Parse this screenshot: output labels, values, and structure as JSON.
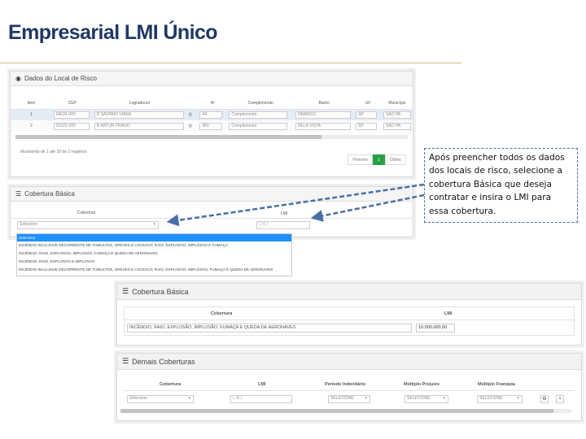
{
  "slide": {
    "title": "Empresarial LMI Único"
  },
  "risk_panel": {
    "title": "Dados do Local de Risco",
    "columns": [
      "Item",
      "CEP",
      "Logradouro",
      "",
      "Nº",
      "Complemento",
      "Bairro",
      "UF",
      "Município"
    ],
    "rows": [
      {
        "item": "1",
        "cep": "04024-000",
        "logradouro": "R SAVPAIO VIANA",
        "numero": "44",
        "complemento": "Complemento",
        "bairro": "PARAISO",
        "uf": "SP",
        "municipio": "SAO PA"
      },
      {
        "item": "2",
        "cep": "01322-000",
        "logradouro": "R ARTUR PRADO",
        "numero": "450",
        "complemento": "Complemento",
        "bairro": "BELA VISTA",
        "uf": "SP",
        "municipio": "SAO PA"
      }
    ],
    "footer": "Mostrando de 1 até 20 de 2 registros",
    "pager": {
      "first": "Primeiro",
      "page": "1",
      "last": "Último"
    }
  },
  "coverage_small": {
    "title": "Cobertura Básica",
    "col_cobertura": "Cobertura",
    "col_lmi": "LMI",
    "select_value": "Selecione",
    "lmi_placeholder": "L.M.I",
    "options": [
      "Selecione",
      "INCÊNDIO INCLUSIVE DECORRENTE DE TUMULTOS, GREVES E LOCKOUT, RAIO, EXPLOSÃO, IMPLOSÃO E FUMAÇA",
      "INCÊNDIO, RAIO, EXPLOSÃO, IMPLOSÃO, FUMAÇA E QUEDA DE AERONAVES",
      "INCÊNDIO, RAIO, EXPLOSÃO E IMPLOSÃO",
      "INCÊNDIO INCLUSIVE DECORRENTE DE TUMULTOS, GREVES E LOCKOUT, RAIO, EXPLOSÃO, IMPLOSÃO, FUMAÇA E QUEDA DE AERONAVES"
    ]
  },
  "coverage_large": {
    "title": "Cobertura Básica",
    "col_cobertura": "Cobertura",
    "col_lmi": "LMI",
    "cobertura_value": "INCÊNDIO, RAIO, EXPLOSÃO, IMPLOSÃO, FUMAÇA E QUEDA DE AERONAVES",
    "lmi_value": "10.000.000,00"
  },
  "other_coverages": {
    "title": "Demais Coberturas",
    "columns": [
      "Cobertura",
      "LMI",
      "Período Indenitário",
      "Múltiplo Prejuízo",
      "Múltiplo Franquia"
    ],
    "cobertura_value": "Selecione",
    "lmi_placeholder": "L.M.I.",
    "periodo_value": "SELECIONE",
    "prejuizo_value": "SELECIONE",
    "franquia_value": "SELECIONE"
  },
  "callout": {
    "text": "Após preencher todos os dados dos locais de risco, selecione a cobertura Básica que deseja contratar e insira o LMI para essa cobertura."
  },
  "colors": {
    "title": "#1f3864",
    "accent_green": "#27a048",
    "dropdown_highlight": "#1e90ff",
    "callout_border": "#4a6fa5"
  }
}
